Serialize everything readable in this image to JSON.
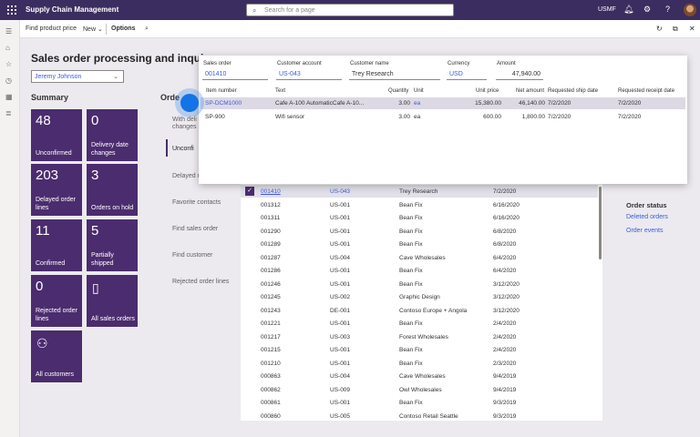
{
  "topbar": {
    "app_title": "Supply Chain Management",
    "search_placeholder": "Search for a page",
    "company": "USMF"
  },
  "actionbar": {
    "find_product_price": "Find product price",
    "new": "New",
    "options": "Options"
  },
  "page": {
    "title": "Sales order processing and inquiry",
    "user": "Jeremy Johnson",
    "summary_title": "Summary"
  },
  "tiles": [
    {
      "num": "48",
      "label": "Unconfirmed"
    },
    {
      "num": "0",
      "label": "Delivery date changes"
    },
    {
      "num": "203",
      "label": "Delayed order lines"
    },
    {
      "num": "3",
      "label": "Orders on hold"
    },
    {
      "num": "11",
      "label": "Confirmed"
    },
    {
      "num": "5",
      "label": "Partially shipped"
    },
    {
      "num": "0",
      "label": "Rejected order lines"
    },
    {
      "num": "",
      "label": "All sales orders"
    },
    {
      "num": "",
      "label": "All customers"
    }
  ],
  "middle": {
    "title": "Orde",
    "items": [
      "With deli",
      "changes",
      "Unconfi",
      "Delayed o",
      "Favorite contacts",
      "Find sales order",
      "Find customer",
      "Rejected order lines"
    ]
  },
  "grid": {
    "rows": [
      {
        "order": "001410",
        "account": "US-043",
        "name": "Trey Research",
        "date": "7/2/2020"
      },
      {
        "order": "001312",
        "account": "US-001",
        "name": "Bean Fix",
        "date": "6/16/2020"
      },
      {
        "order": "001311",
        "account": "US-001",
        "name": "Bean Fix",
        "date": "6/16/2020"
      },
      {
        "order": "001290",
        "account": "US-001",
        "name": "Bean Fix",
        "date": "6/8/2020"
      },
      {
        "order": "001289",
        "account": "US-001",
        "name": "Bean Fix",
        "date": "6/8/2020"
      },
      {
        "order": "001287",
        "account": "US-004",
        "name": "Cave Wholesales",
        "date": "6/4/2020"
      },
      {
        "order": "001286",
        "account": "US-001",
        "name": "Bean Fix",
        "date": "6/4/2020"
      },
      {
        "order": "001246",
        "account": "US-001",
        "name": "Bean Fix",
        "date": "3/12/2020"
      },
      {
        "order": "001245",
        "account": "US-002",
        "name": "Graphic Design",
        "date": "3/12/2020"
      },
      {
        "order": "001243",
        "account": "DE-001",
        "name": "Contoso Europe + Angola",
        "date": "3/12/2020"
      },
      {
        "order": "001221",
        "account": "US-001",
        "name": "Bean Fix",
        "date": "2/4/2020"
      },
      {
        "order": "001217",
        "account": "US-003",
        "name": "Forest Wholesales",
        "date": "2/4/2020"
      },
      {
        "order": "001215",
        "account": "US-001",
        "name": "Bean Fix",
        "date": "2/4/2020"
      },
      {
        "order": "001210",
        "account": "US-001",
        "name": "Bean Fix",
        "date": "2/3/2020"
      },
      {
        "order": "000863",
        "account": "US-004",
        "name": "Cave Wholesales",
        "date": "9/4/2019"
      },
      {
        "order": "000862",
        "account": "US-009",
        "name": "Owl Wholesales",
        "date": "9/4/2019"
      },
      {
        "order": "000861",
        "account": "US-001",
        "name": "Bean Fix",
        "date": "9/3/2019"
      },
      {
        "order": "000860",
        "account": "US-005",
        "name": "Contoso Retail Seattle",
        "date": "9/3/2019"
      }
    ]
  },
  "order_status": {
    "title": "Order status",
    "links": [
      "Deleted orders",
      "Order events"
    ]
  },
  "popup": {
    "header_labels": {
      "sales_order": "Sales order",
      "customer_account": "Customer account",
      "customer_name": "Customer name",
      "currency": "Currency",
      "amount": "Amount"
    },
    "header_values": {
      "sales_order": "001410",
      "customer_account": "US-043",
      "customer_name": "Trey Research",
      "currency": "USD",
      "amount": "47,940.00"
    },
    "line_headers": [
      "Item number",
      "Text",
      "Quantity",
      "Unit",
      "Unit price",
      "Net amount",
      "Requested ship date",
      "Requested receipt date"
    ],
    "lines": [
      {
        "item": "SP-DCM1000",
        "text": "Cafe A-100 AutomaticCafe A-10...",
        "qty": "3.00",
        "unit": "ea",
        "price": "15,380.00",
        "net": "46,140.00",
        "ship": "7/2/2020",
        "receipt": "7/2/2020"
      },
      {
        "item": "SP-900",
        "text": "Wifi sensor",
        "qty": "3.00",
        "unit": "ea",
        "price": "600.00",
        "net": "1,800.00",
        "ship": "7/2/2020",
        "receipt": "7/2/2020"
      }
    ]
  },
  "colors": {
    "topbar": "#3b2d5f",
    "tile": "#4b2c6e",
    "link": "#3b5bdb",
    "cursor": "#1473e6"
  }
}
